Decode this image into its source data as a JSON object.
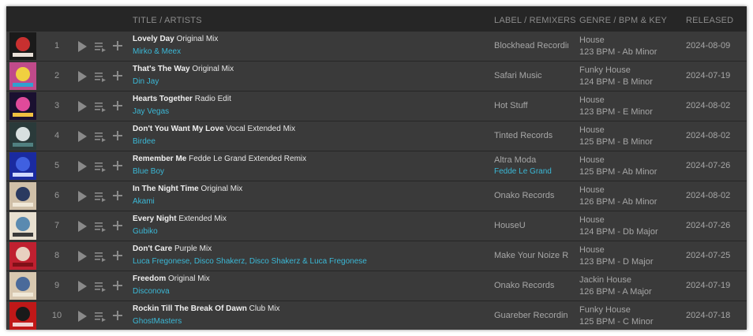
{
  "header": {
    "title_artists": "TITLE / ARTISTS",
    "label_remixers": "LABEL / REMIXERS",
    "genre_bpm_key": "GENRE / BPM & KEY",
    "released": "RELEASED"
  },
  "tracks": [
    {
      "num": "1",
      "title": "Lovely Day",
      "mix": "Original Mix",
      "artists": "Mirko & Meex",
      "label": "Blockhead Recordings",
      "remixer": "",
      "genre": "House",
      "bpm_key": "123 BPM - Ab Minor",
      "released": "2024-08-09",
      "cover": {
        "bg": "#1a1a1a",
        "fg": "#c83030",
        "accent": "#e8e0d8"
      }
    },
    {
      "num": "2",
      "title": "That's The Way",
      "mix": "Original Mix",
      "artists": "Din Jay",
      "label": "Safari Music",
      "remixer": "",
      "genre": "Funky House",
      "bpm_key": "124 BPM - B Minor",
      "released": "2024-07-19",
      "cover": {
        "bg": "#c04a8a",
        "fg": "#f0d040",
        "accent": "#30a0d0"
      }
    },
    {
      "num": "3",
      "title": "Hearts Together",
      "mix": "Radio Edit",
      "artists": "Jay Vegas",
      "label": "Hot Stuff",
      "remixer": "",
      "genre": "House",
      "bpm_key": "123 BPM - E Minor",
      "released": "2024-08-02",
      "cover": {
        "bg": "#1a1030",
        "fg": "#e04a9a",
        "accent": "#f0c040"
      }
    },
    {
      "num": "4",
      "title": "Don't You Want My Love",
      "mix": "Vocal Extended Mix",
      "artists": "Birdee",
      "label": "Tinted Records",
      "remixer": "",
      "genre": "House",
      "bpm_key": "125 BPM - B Minor",
      "released": "2024-08-02",
      "cover": {
        "bg": "#2a3a3a",
        "fg": "#d8e0e0",
        "accent": "#508080"
      }
    },
    {
      "num": "5",
      "title": "Remember Me",
      "mix": "Fedde Le Grand Extended Remix",
      "artists": "Blue Boy",
      "label": "Altra Moda",
      "remixer": "Fedde Le Grand",
      "genre": "House",
      "bpm_key": "125 BPM - Ab Minor",
      "released": "2024-07-26",
      "cover": {
        "bg": "#1a2aa0",
        "fg": "#4060e0",
        "accent": "#d0d8ff"
      }
    },
    {
      "num": "6",
      "title": "In The Night Time",
      "mix": "Original Mix",
      "artists": "Akami",
      "label": "Onako Records",
      "remixer": "",
      "genre": "House",
      "bpm_key": "126 BPM - Ab Minor",
      "released": "2024-08-02",
      "cover": {
        "bg": "#d0c0a8",
        "fg": "#2a3a60",
        "accent": "#f0e8d8"
      }
    },
    {
      "num": "7",
      "title": "Every Night",
      "mix": "Extended Mix",
      "artists": "Gubiko",
      "label": "HouseU",
      "remixer": "",
      "genre": "House",
      "bpm_key": "124 BPM - Db Major",
      "released": "2024-07-26",
      "cover": {
        "bg": "#e8e0d0",
        "fg": "#5a8ab0",
        "accent": "#3a3a3a"
      }
    },
    {
      "num": "8",
      "title": "Don't Care",
      "mix": "Purple Mix",
      "artists": "Luca Fregonese, Disco Shakerz, Disco Shakerz & Luca Fregonese",
      "label": "Make Your Noize Records",
      "remixer": "",
      "genre": "House",
      "bpm_key": "123 BPM - D Major",
      "released": "2024-07-25",
      "cover": {
        "bg": "#c02030",
        "fg": "#e8d0c0",
        "accent": "#801018"
      }
    },
    {
      "num": "9",
      "title": "Freedom",
      "mix": "Original Mix",
      "artists": "Disconova",
      "label": "Onako Records",
      "remixer": "",
      "genre": "Jackin House",
      "bpm_key": "126 BPM - A Major",
      "released": "2024-07-19",
      "cover": {
        "bg": "#d8c8b0",
        "fg": "#4a6a9a",
        "accent": "#f0e8d8"
      }
    },
    {
      "num": "10",
      "title": "Rockin Till The Break Of Dawn",
      "mix": "Club Mix",
      "artists": "GhostMasters",
      "label": "Guareber Recordings",
      "remixer": "",
      "genre": "Funky House",
      "bpm_key": "125 BPM - C Minor",
      "released": "2024-07-18",
      "cover": {
        "bg": "#c01818",
        "fg": "#1a1a1a",
        "accent": "#f0d0d0"
      }
    }
  ],
  "icons": {
    "play": "play-icon",
    "queue": "add-to-queue-icon",
    "add": "add-to-playlist-icon"
  },
  "colors": {
    "row_bg": "#3a3a3a",
    "header_bg": "#262626",
    "link": "#3bb8d6",
    "text": "#a6a6a6"
  }
}
